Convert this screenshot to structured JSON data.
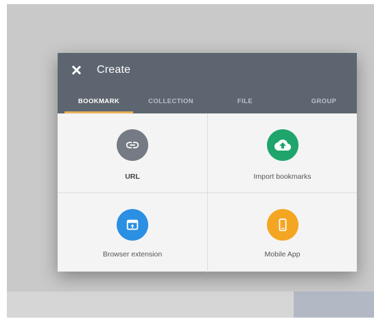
{
  "dialog": {
    "title": "Create",
    "tabs": [
      {
        "label": "BOOKMARK",
        "active": true
      },
      {
        "label": "COLLECTION",
        "active": false
      },
      {
        "label": "FILE",
        "active": false
      },
      {
        "label": "GROUP",
        "active": false
      }
    ],
    "options": [
      {
        "label": "URL",
        "icon": "link-icon",
        "color": "#757b84"
      },
      {
        "label": "Import bookmarks",
        "icon": "cloud-upload-icon",
        "color": "#1fa56c"
      },
      {
        "label": "Browser extension",
        "icon": "browser-window-icon",
        "color": "#2b8fe3"
      },
      {
        "label": "Mobile App",
        "icon": "mobile-phone-icon",
        "color": "#f4a623"
      }
    ]
  },
  "colors": {
    "header": "#5d6670",
    "active_tab_indicator": "#e8b15a"
  }
}
